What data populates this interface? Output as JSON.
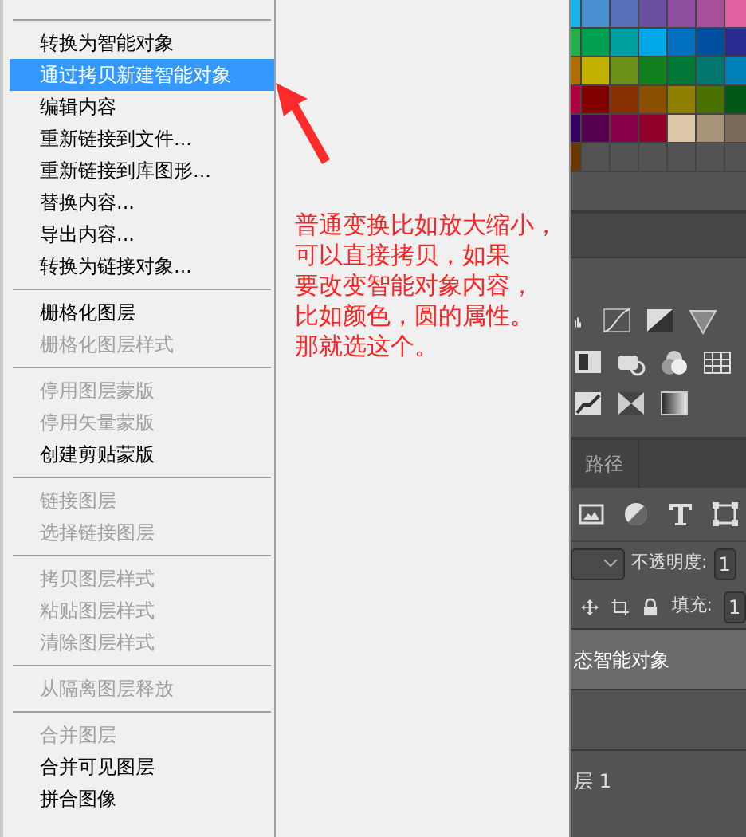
{
  "menu": {
    "items": [
      {
        "kind": "separator"
      },
      {
        "kind": "item",
        "label": "转换为智能对象",
        "disabled": false,
        "selected": false
      },
      {
        "kind": "item",
        "label": "通过拷贝新建智能对象",
        "disabled": false,
        "selected": true
      },
      {
        "kind": "item",
        "label": "编辑内容",
        "disabled": false,
        "selected": false
      },
      {
        "kind": "item",
        "label": "重新链接到文件...",
        "disabled": false,
        "selected": false
      },
      {
        "kind": "item",
        "label": "重新链接到库图形...",
        "disabled": false,
        "selected": false
      },
      {
        "kind": "item",
        "label": "替换内容...",
        "disabled": false,
        "selected": false
      },
      {
        "kind": "item",
        "label": "导出内容...",
        "disabled": false,
        "selected": false
      },
      {
        "kind": "item",
        "label": "转换为链接对象...",
        "disabled": false,
        "selected": false
      },
      {
        "kind": "separator"
      },
      {
        "kind": "item",
        "label": "栅格化图层",
        "disabled": false,
        "selected": false
      },
      {
        "kind": "item",
        "label": "栅格化图层样式",
        "disabled": true,
        "selected": false
      },
      {
        "kind": "separator"
      },
      {
        "kind": "item",
        "label": "停用图层蒙版",
        "disabled": true,
        "selected": false
      },
      {
        "kind": "item",
        "label": "停用矢量蒙版",
        "disabled": true,
        "selected": false
      },
      {
        "kind": "item",
        "label": "创建剪贴蒙版",
        "disabled": false,
        "selected": false
      },
      {
        "kind": "separator"
      },
      {
        "kind": "item",
        "label": "链接图层",
        "disabled": true,
        "selected": false
      },
      {
        "kind": "item",
        "label": "选择链接图层",
        "disabled": true,
        "selected": false
      },
      {
        "kind": "separator"
      },
      {
        "kind": "item",
        "label": "拷贝图层样式",
        "disabled": true,
        "selected": false
      },
      {
        "kind": "item",
        "label": "粘贴图层样式",
        "disabled": true,
        "selected": false
      },
      {
        "kind": "item",
        "label": "清除图层样式",
        "disabled": true,
        "selected": false
      },
      {
        "kind": "separator"
      },
      {
        "kind": "item",
        "label": "从隔离图层释放",
        "disabled": true,
        "selected": false
      },
      {
        "kind": "separator"
      },
      {
        "kind": "item",
        "label": "合并图层",
        "disabled": true,
        "selected": false
      },
      {
        "kind": "item",
        "label": "合并可见图层",
        "disabled": false,
        "selected": false
      },
      {
        "kind": "item",
        "label": "拼合图像",
        "disabled": false,
        "selected": false
      }
    ]
  },
  "annotation": {
    "lines": [
      "普通变换比如放大缩小，",
      "可以直接拷贝，如果",
      "要改变智能对象内容，",
      "比如颜色，圆的属性。",
      "那就选这个。"
    ]
  },
  "panel": {
    "tabs": [
      {
        "label": "路径",
        "selected": false
      }
    ],
    "opacity_label": "不透明度:",
    "opacity_value": "1",
    "fill_label": "填充:",
    "fill_value": "1",
    "layers": [
      {
        "name": "态智能对象",
        "selected": true
      },
      {
        "selected": false
      },
      {
        "name": "层 1",
        "selected": false
      }
    ]
  }
}
